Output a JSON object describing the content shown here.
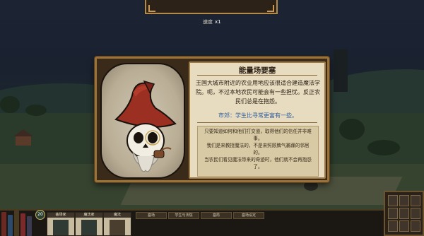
{
  "hud": {
    "speed_label": "速度",
    "speed_value": "x1"
  },
  "dialog": {
    "title": "能量场要塞",
    "paragraph": "王国大城市附近的农业用地应该很适合建造魔法学院。呃，不过本地农民可能会有一些担忧。反正农民们总是在抱怨。",
    "option": "市郊：学生比寻常更富有一些。",
    "detail_lines": [
      "只要知道如何和他们打交道，取得他们的信任并非难事。",
      "我们是来教授魔法的，不是来照顾脾气暴躁的邻居的。",
      "当农民们看见魔法带来的奇迹时，他们就不会再抱怨了。"
    ]
  },
  "bottom": {
    "coin_count": "20",
    "cards": [
      {
        "title": "塞场家"
      },
      {
        "title": "魔法家"
      },
      {
        "title": "魔法"
      }
    ],
    "tabs": [
      {
        "label": "塞场"
      },
      {
        "label": "学生与法院"
      },
      {
        "label": "塞局"
      },
      {
        "label": "塞场设定"
      }
    ]
  },
  "colors": {
    "parchment": "#e7dcc0",
    "frame": "#9c7236",
    "option_blue": "#2e5c9e",
    "hat_red": "#9a2f22"
  },
  "icons": {
    "portrait": "skull-wizard-portrait",
    "coin": "coin-icon"
  }
}
